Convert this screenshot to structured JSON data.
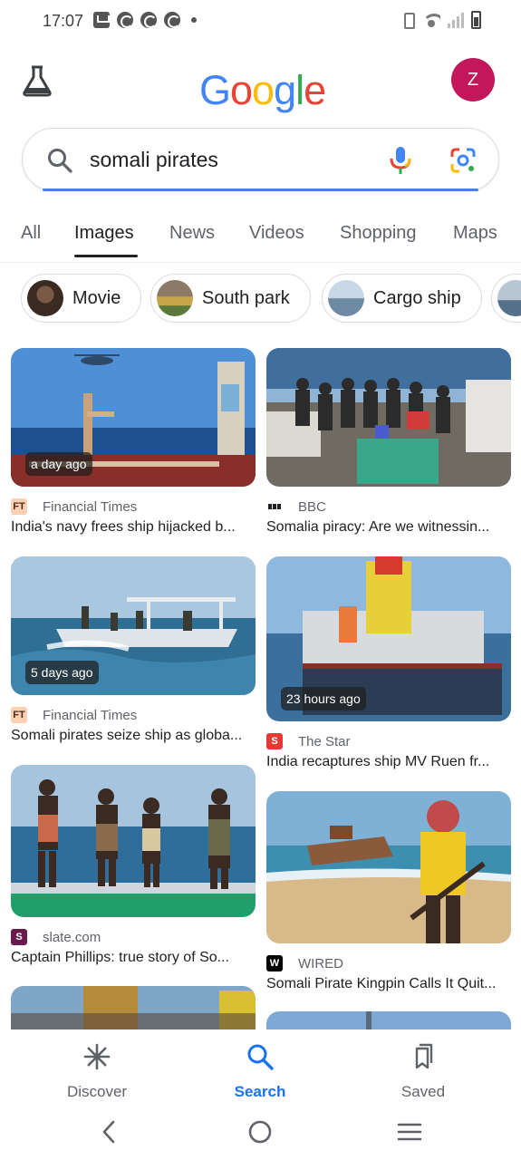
{
  "status_bar": {
    "time": "17:07"
  },
  "header": {
    "logo_letters": [
      "G",
      "o",
      "o",
      "g",
      "l",
      "e"
    ],
    "logo_colors": [
      "#4285F4",
      "#EA4335",
      "#FBBC05",
      "#4285F4",
      "#34A853",
      "#EA4335"
    ],
    "avatar_initial": "Z",
    "avatar_color": "#c2185b"
  },
  "search": {
    "query": "somali pirates"
  },
  "tabs": [
    {
      "label": "All"
    },
    {
      "label": "Images",
      "active": true
    },
    {
      "label": "News"
    },
    {
      "label": "Videos"
    },
    {
      "label": "Shopping"
    },
    {
      "label": "Maps"
    }
  ],
  "chips": [
    {
      "label": "Movie"
    },
    {
      "label": "South park"
    },
    {
      "label": "Cargo ship"
    }
  ],
  "results": [
    {
      "source": "Financial Times",
      "title": "India's navy frees ship hijacked b...",
      "time": "a day ago",
      "favicon": "FT"
    },
    {
      "source": "BBC",
      "title": "Somalia piracy: Are we witnessin..."
    },
    {
      "source": "Financial Times",
      "title": "Somali pirates seize ship as globa...",
      "time": "5 days ago",
      "favicon": "FT"
    },
    {
      "source": "The Star",
      "title": "India recaptures ship MV Ruen fr...",
      "time": "23 hours ago",
      "favicon": "S"
    },
    {
      "source": "slate.com",
      "title": "Captain Phillips: true story of So...",
      "favicon": "S"
    },
    {
      "source": "WIRED",
      "title": "Somali Pirate Kingpin Calls It Quit...",
      "favicon": "W"
    }
  ],
  "bottom_nav": [
    {
      "label": "Discover",
      "icon": "asterisk-icon"
    },
    {
      "label": "Search",
      "icon": "search-icon",
      "active": true
    },
    {
      "label": "Saved",
      "icon": "bookmarks-icon"
    }
  ],
  "colors": {
    "accent": "#1a73e8",
    "ft_favicon_bg": "#fcd0b1",
    "star_favicon_bg": "#e53935",
    "slate_favicon_bg": "#6a1b4d"
  }
}
